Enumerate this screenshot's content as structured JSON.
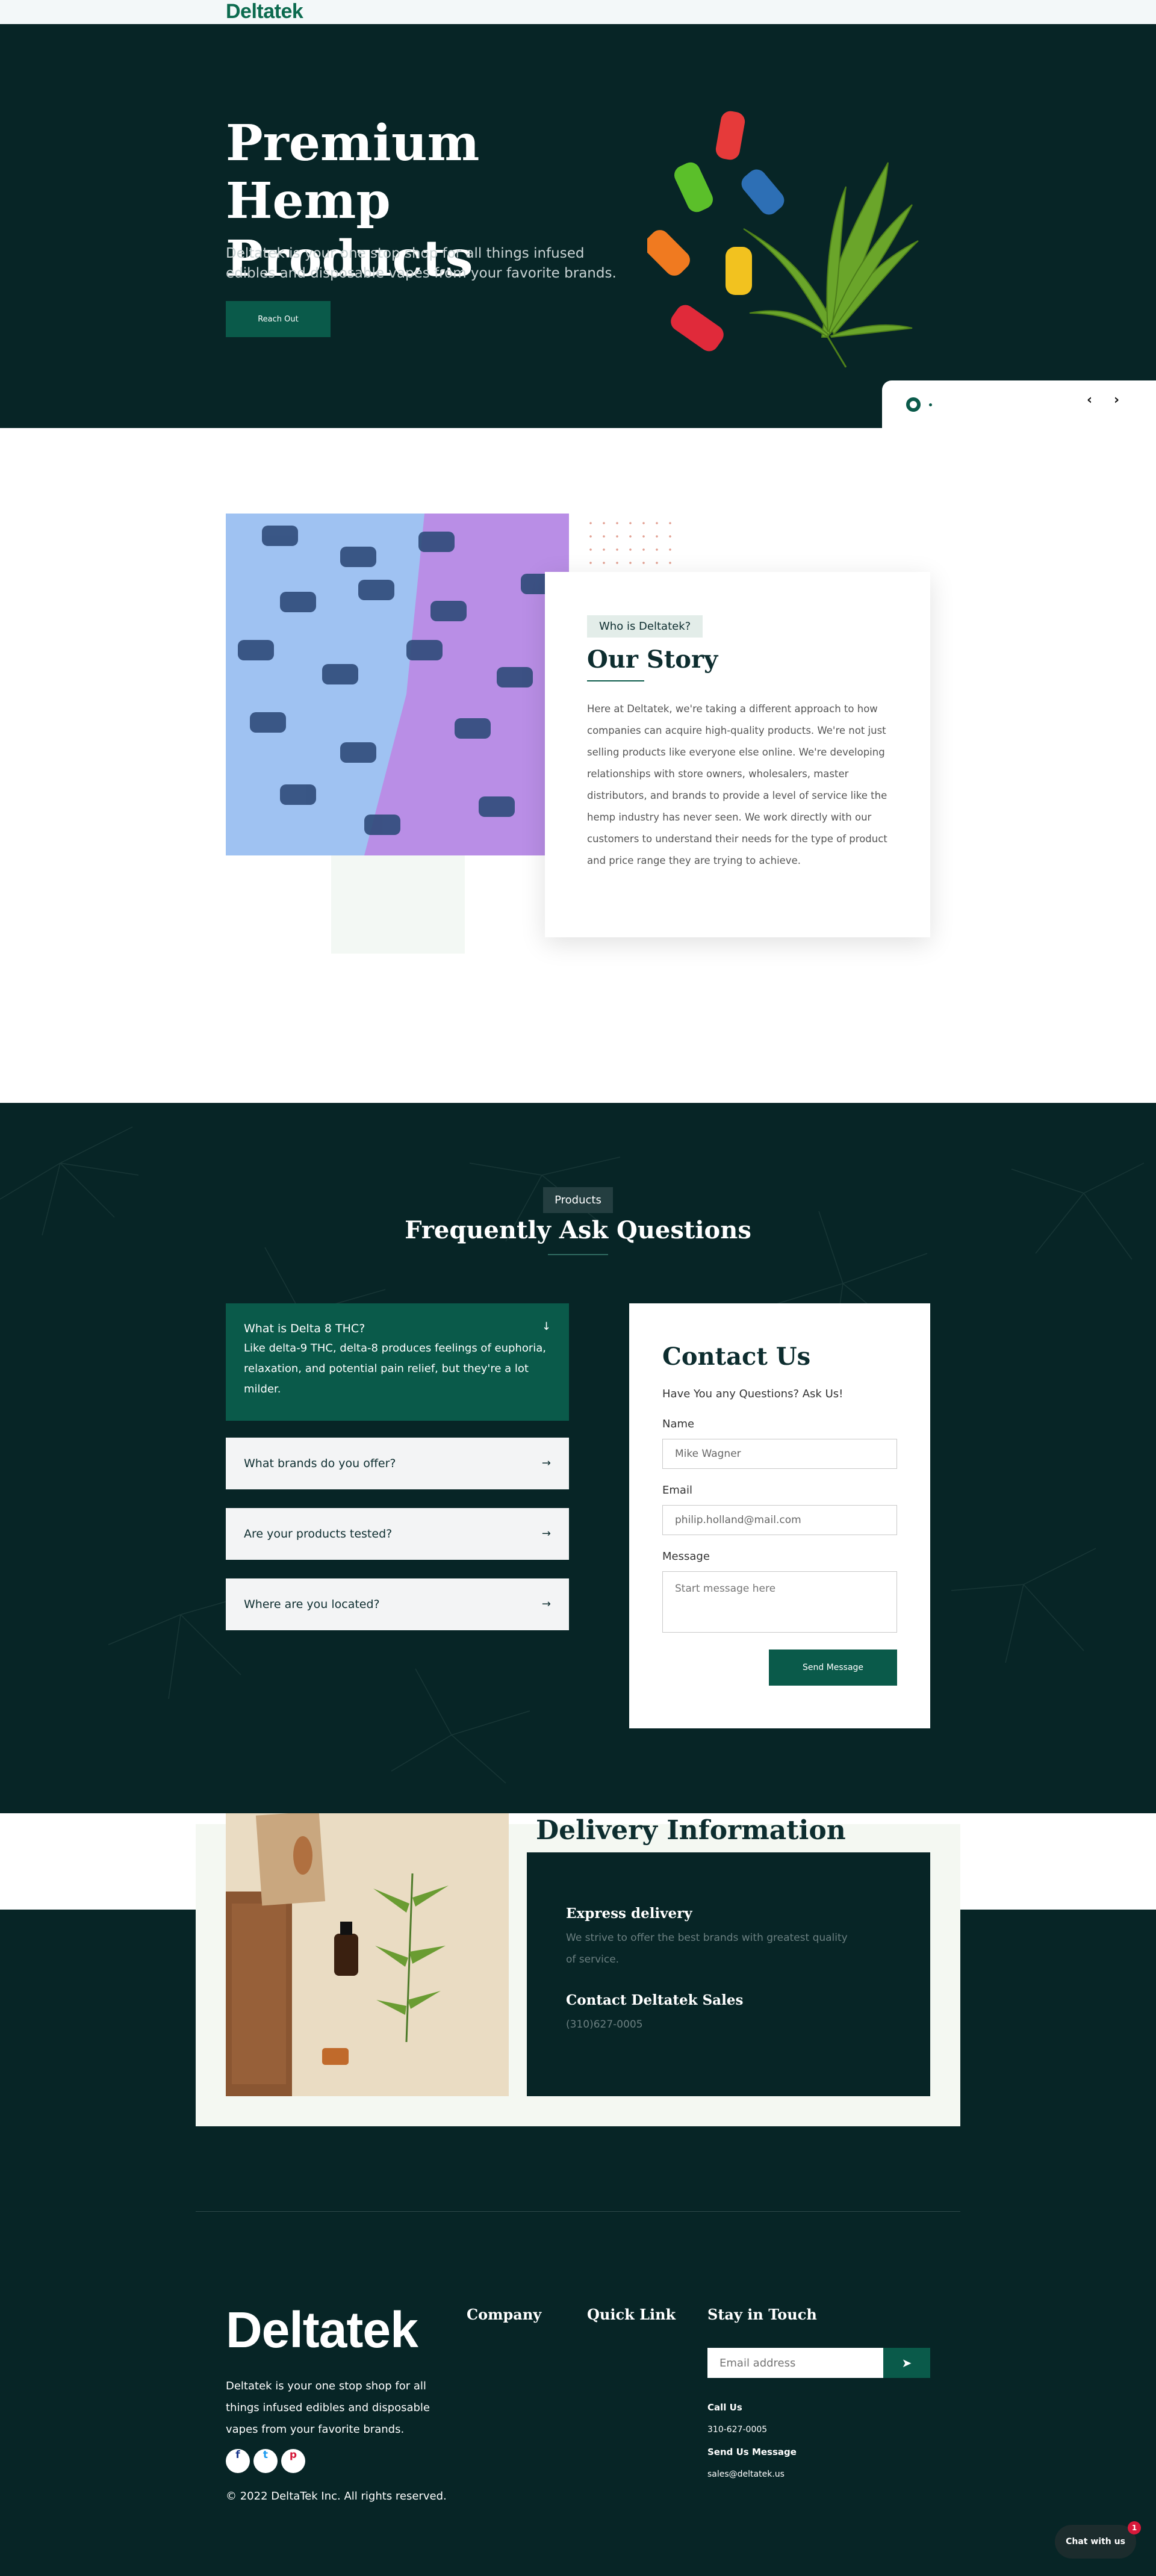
{
  "brand": "Deltatek",
  "hero": {
    "title": "Premium Hemp Products",
    "subtitle": "Deltatek is your one stop shop for all things infused edibles and disposable vapes from your favorite brands.",
    "cta": "Reach Out"
  },
  "story": {
    "tag": "Who is Deltatek?",
    "title": "Our Story",
    "body": "Here at Deltatek, we're taking a different approach to how companies can acquire high-quality products. We're not just selling products like everyone else online. We're developing relationships with store owners, wholesalers, master distributors, and brands to provide a level of service like the hemp industry has never seen. We work directly with our customers to understand their needs for the type of product and price range they are trying to achieve."
  },
  "faq": {
    "tag": "Products",
    "title": "Frequently Ask Questions",
    "items": [
      {
        "question": "What is Delta 8 THC?",
        "answer": "Like delta-9 THC, delta-8 produces feelings of euphoria, relaxation, and potential pain relief, but they're a lot milder."
      },
      {
        "question": "What brands do you offer?"
      },
      {
        "question": "Are your products tested?"
      },
      {
        "question": "Where are you located?"
      }
    ]
  },
  "contact": {
    "title": "Contact Us",
    "subtitle": "Have You any Questions? Ask Us!",
    "name_label": "Name",
    "name_value": "Mike Wagner",
    "email_label": "Email",
    "email_value": "philip.holland@mail.com",
    "message_label": "Message",
    "message_placeholder": "Start message here",
    "submit": "Send Message"
  },
  "delivery": {
    "title": "Delivery Information",
    "express_title": "Express delivery",
    "express_text": "We strive to offer the best brands with greatest quality of service.",
    "sales_title": "Contact Deltatek Sales",
    "sales_phone": "(310)627-0005"
  },
  "footer": {
    "logo": "Deltatek",
    "description": "Deltatek is your one stop shop for all things infused edibles and disposable vapes from your favorite brands.",
    "copyright": "© 2022 DeltaTek Inc. All rights reserved.",
    "col_company": "Company",
    "col_quick": "Quick Link",
    "col_touch": "Stay in Touch",
    "email_placeholder": "Email address",
    "call_label": "Call Us",
    "call_value": "310-627-0005",
    "msg_label": "Send Us Message",
    "msg_value": "sales@deltatek.us",
    "social": [
      "facebook-icon",
      "twitter-icon",
      "pinterest-icon"
    ]
  },
  "chat": {
    "label": "Chat with us",
    "badge": "1"
  },
  "colors": {
    "dark": "#072526",
    "accent": "#0a5a4a",
    "light": "#f3f8f9"
  }
}
